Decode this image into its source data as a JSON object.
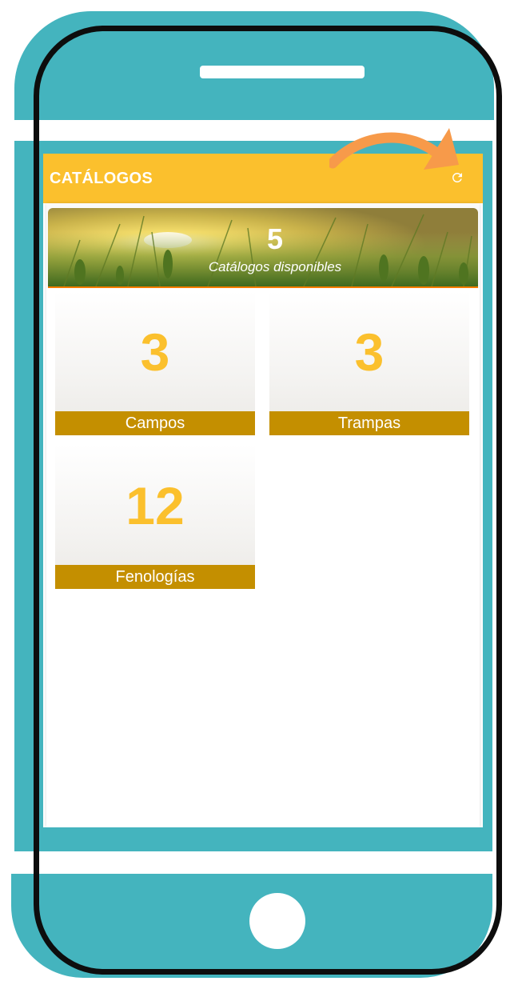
{
  "app_bar": {
    "title": "CATÁLOGOS",
    "refresh_icon": "refresh-icon",
    "color": "#fbc02d"
  },
  "banner": {
    "count": "5",
    "subtitle": "Catálogos disponibles",
    "accent": "#f57c00"
  },
  "catalogs": [
    {
      "count": "3",
      "label": "Campos"
    },
    {
      "count": "3",
      "label": "Trampas"
    },
    {
      "count": "12",
      "label": "Fenologías"
    }
  ],
  "colors": {
    "frame_teal": "#44b4be",
    "label_bar": "#c48f00",
    "count_text": "#fbc02d",
    "annotation_arrow": "#f79a4a"
  }
}
